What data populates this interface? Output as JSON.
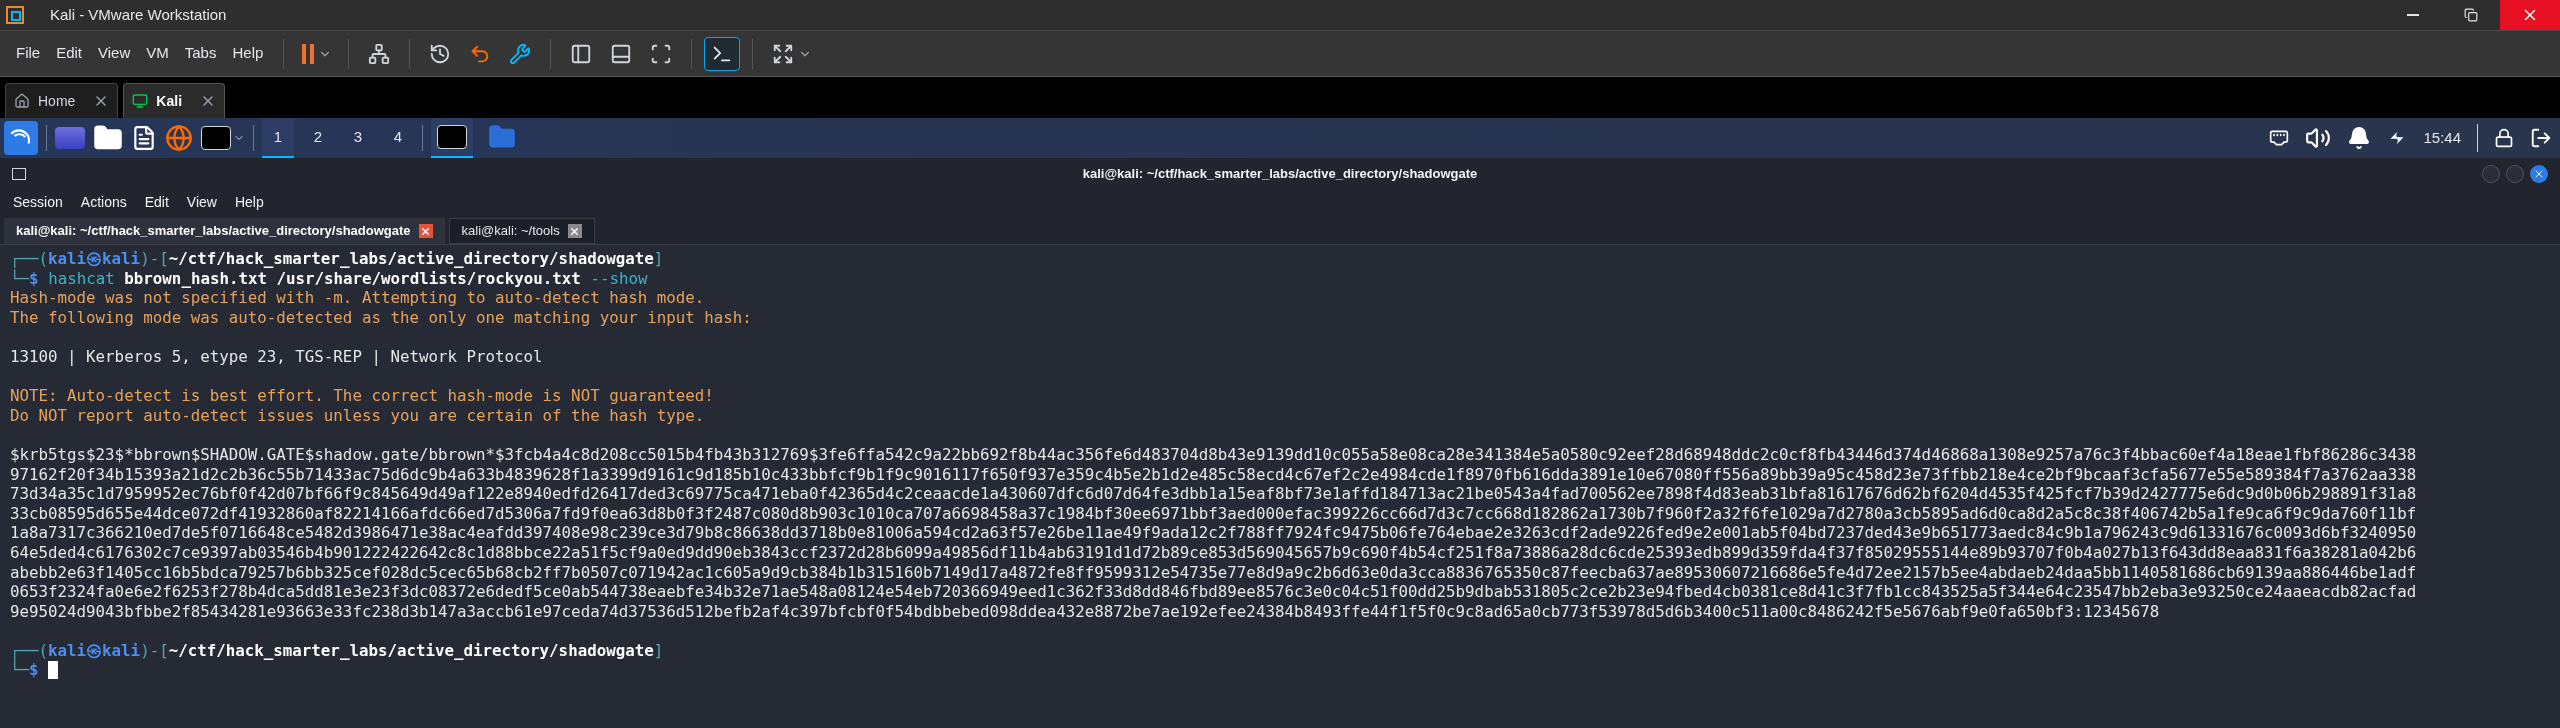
{
  "vmware": {
    "title": "Kali - VMware Workstation",
    "menu": [
      "File",
      "Edit",
      "View",
      "VM",
      "Tabs",
      "Help"
    ],
    "toolbar": [
      {
        "kind": "pause",
        "on": false
      },
      {
        "kind": "send-keys",
        "on": false
      },
      {
        "kind": "snapshot-take",
        "on": false
      },
      {
        "kind": "snapshot-revert",
        "on": false
      },
      {
        "kind": "snapshot-manage",
        "on": false
      },
      {
        "kind": "library",
        "on": false
      },
      {
        "kind": "thumbnail",
        "on": false
      },
      {
        "kind": "fit",
        "on": false
      },
      {
        "kind": "console",
        "on": true
      },
      {
        "kind": "fullscreen",
        "on": false
      }
    ],
    "tabs": [
      {
        "kind": "home",
        "label": "Home",
        "selected": false
      },
      {
        "kind": "vm",
        "label": "Kali",
        "selected": true
      }
    ]
  },
  "panel": {
    "workspaces": [
      {
        "label": "1",
        "selected": true
      },
      {
        "label": "2",
        "selected": false
      },
      {
        "label": "3",
        "selected": false
      },
      {
        "label": "4",
        "selected": false
      }
    ],
    "tasks": [
      {
        "kind": "terminal",
        "selected": true
      },
      {
        "kind": "folder",
        "selected": false
      }
    ],
    "clock": "15:44"
  },
  "terminal": {
    "title": "kali@kali: ~/ctf/hack_smarter_labs/active_directory/shadowgate",
    "menu": [
      "Session",
      "Actions",
      "Edit",
      "View",
      "Help"
    ],
    "tabs": [
      {
        "label": "kali@kali: ~/ctf/hack_smarter_labs/active_directory/shadowgate",
        "selected": true
      },
      {
        "label": "kali@kali: ~/tools",
        "selected": false
      }
    ],
    "lines": [
      {
        "kind": "segments",
        "parts": [
          {
            "kind": "frame",
            "text": "┌──("
          },
          {
            "kind": "user",
            "text": "kali㉿kali"
          },
          {
            "kind": "frame",
            "text": ")-["
          },
          {
            "kind": "path",
            "text": "~/ctf/hack_smarter_labs/active_directory/shadowgate"
          },
          {
            "kind": "frame",
            "text": "]"
          }
        ]
      },
      {
        "kind": "segments",
        "parts": [
          {
            "kind": "frame",
            "text": "└─"
          },
          {
            "kind": "user",
            "text": "$"
          },
          {
            "kind": "command",
            "text": "hashcat"
          },
          {
            "kind": "arg",
            "text": "bbrown_hash.txt /usr/share/wordlists/rockyou.txt"
          },
          {
            "kind": "option",
            "text": "--show"
          }
        ]
      },
      {
        "kind": "warning",
        "text": "Hash-mode was not specified with -m. Attempting to auto-detect hash mode."
      },
      {
        "kind": "warning",
        "text": "The following mode was auto-detected as the only one matching your input hash:"
      },
      {
        "kind": "blank"
      },
      {
        "kind": "output",
        "text": "13100 | Kerberos 5, etype 23, TGS-REP | Network Protocol"
      },
      {
        "kind": "blank"
      },
      {
        "kind": "warning",
        "text": "NOTE: Auto-detect is best effort. The correct hash-mode is NOT guaranteed!"
      },
      {
        "kind": "warning",
        "text": "Do NOT report auto-detect issues unless you are certain of the hash type."
      },
      {
        "kind": "blank"
      },
      {
        "kind": "output",
        "text": "$krb5tgs$23$*bbrown$SHADOW.GATE$shadow.gate/bbrown*$3fcb4a4c8d208cc5015b4fb43b312769$3fe6ffa542c9a22bb692f8b44ac356fe6d483704d8b43e9139dd10c055a58e08ca28e341384e5a0580c92eef28d68948ddc2c0cf8fb43446d374d46868a1308e9257a76c3f4bbac60ef4a18eae1fbf86286c3438"
      },
      {
        "kind": "output",
        "text": "97162f20f34b15393a21d2c2b36c55b71433ac75d6dc9b4a633b4839628f1a3399d9161c9d185b10c433bbfcf9b1f9c9016117f650f937e359c4b5e2b1d2e485c58ecd4c67ef2c2e4984cde1f8970fb616dda3891e10e67080ff556a89bb39a95c458d23e73ffbb218e4ce2bf9bcaaf3cfa5677e55e589384f7a3762aa338"
      },
      {
        "kind": "output",
        "text": "73d34a35c1d7959952ec76bf0f42d07bf66f9c845649d49af122e8940edfd26417ded3c69775ca471eba0f42365d4c2ceaacde1a430607dfc6d07d64fe3dbb1a15eaf8bf73e1affd184713ac21be0543a4fad700562ee7898f4d83eab31bfa81617676d62bf6204d4535f425fcf7b39d2427775e6dc9d0b06b298891f31a8"
      },
      {
        "kind": "output",
        "text": "33cb08595d655e44dce072df41932860af82214166afdc66ed7d5306a7fd9f0ea63d8b0f3f2487c080d8b903c1010ca707a6698458a37c1984bf30ee6971bbf3aed000efac399226cc66d7d3c7cc668d182862a1730b7f960f2a32f6fe1029a7d2780a3cb5895ad6d0ca8d2a5c8c38f406742b5a1fe9ca6f9c9da760f11bf"
      },
      {
        "kind": "output",
        "text": "1a8a7317c366210ed7de5f0716648ce5482d3986471e38ac4eafdd397408e98c239ce3d79b8c86638dd3718b0e81006a594cd2a63f57e26be11ae49f9ada12c2f788ff7924fc9475b06fe764ebae2e3263cdf2ade9226fed9e2e001ab5f04bd7237ded43e9b651773aedc84c9b1a796243c9d61331676c0093d6bf3240950"
      },
      {
        "kind": "output",
        "text": "64e5ded4c6176302c7ce9397ab03546b4b901222422642c8c1d88bbce22a51f5cf9a0ed9dd90eb3843ccf2372d28b6099a49856df11b4ab63191d1d72b89ce853d569045657b9c690f4b54cf251f8a73886a28dc6cde25393edb899d359fda4f37f85029555144e89b93707f0b4a027b13f643dd8eaa831f6a38281a042b6"
      },
      {
        "kind": "output",
        "text": "abebb2e63f1405cc16b5bdca79257b6bb325cef028dc5cec65b68cb2ff7b0507c071942ac1c605a9d9cb384b1b315160b7149d17a4872fe8ff9599312e54735e77e8d9a9c2b6d63e0da3cca8836765350c87feecba637ae89530607216686e5fe4d72ee2157b5ee4abdaeb24daa5bb1140581686cb69139aa886446be1adf"
      },
      {
        "kind": "output",
        "text": "0653f2324fa0e6e2f6253f278b4dca5dd81e3e23f3dc08372e6dedf5ce0ab544738eaebfe34b32e71ae548a08124e54eb720366949eed1c362f33d8dd846fbd89ee8576c3e0c04c51f00dd25b9dbab531805c2ce2b23e94fbed4cb0381ce8d41c3f7fb1cc843525a5f344e64c23547bb2eba3e93250ce24aaeacdb82acfad"
      },
      {
        "kind": "output",
        "text": "9e95024d9043bfbbe2f85434281e93663e33fc238d3b147a3accb61e97ceda74d37536d512befb2af4c397bfcbf0f54bdbbebed098ddea432e8872be7ae192efee24384b8493ffe44f1f5f0c9c8ad65a0cb773f53978d5d6b3400c511a00c8486242f5e5676abf9e0fa650bf3:12345678"
      },
      {
        "kind": "blank"
      },
      {
        "kind": "segments",
        "parts": [
          {
            "kind": "frame",
            "text": "┌──("
          },
          {
            "kind": "user",
            "text": "kali㉿kali"
          },
          {
            "kind": "frame",
            "text": ")-["
          },
          {
            "kind": "path",
            "text": "~/ctf/hack_smarter_labs/active_directory/shadowgate"
          },
          {
            "kind": "frame",
            "text": "]"
          }
        ]
      },
      {
        "kind": "segments",
        "parts": [
          {
            "kind": "frame",
            "text": "└─"
          },
          {
            "kind": "user",
            "text": "$"
          },
          {
            "kind": "cursor"
          }
        ]
      }
    ]
  }
}
